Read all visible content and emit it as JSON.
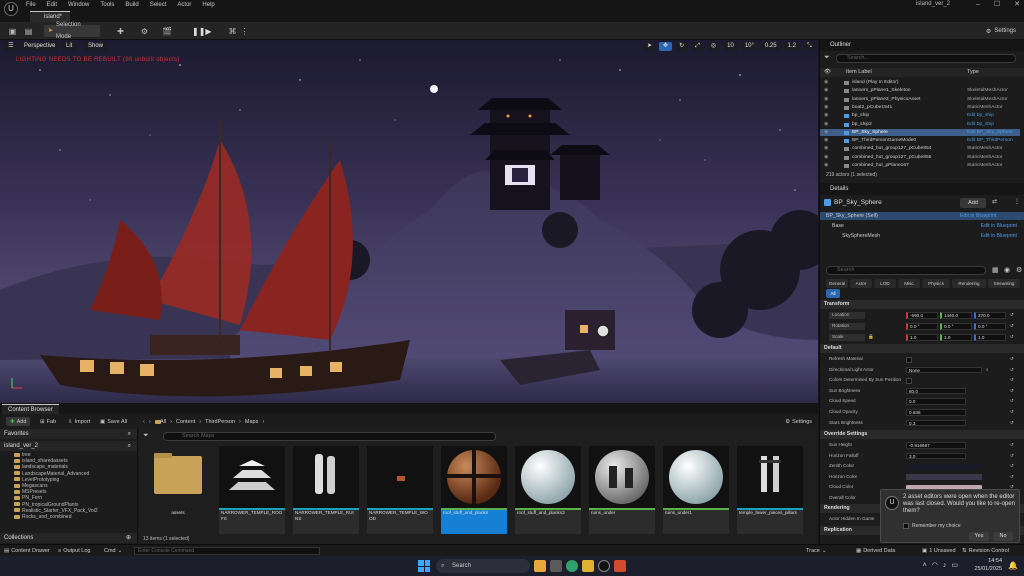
{
  "app": {
    "menu": [
      "File",
      "Edit",
      "Window",
      "Tools",
      "Build",
      "Select",
      "Actor",
      "Help"
    ],
    "project_title": "island_ver_2",
    "level_tab": "island*"
  },
  "toolbar": {
    "selection_mode": "Selection Mode",
    "settings": "Settings"
  },
  "viewport": {
    "perspective": "Perspective",
    "lit": "Lit",
    "show": "Show",
    "warning": "LIGHTING NEEDS TO BE REBUILT (98 unbuilt objects)",
    "snap_values": [
      "10",
      "10°",
      "0.25",
      "1.2"
    ]
  },
  "content_browser": {
    "tab": "Content Browser",
    "add": "Add",
    "import": "Import",
    "save_all": "Save All",
    "fab": "Fab",
    "settings": "Settings",
    "path": [
      "All",
      "Content",
      "ThirdPerson",
      "Maps"
    ],
    "favorites": "Favorites",
    "project_root": "island_ver_2",
    "collections": "Collections",
    "search_placeholder": "Search Maps",
    "tree": [
      "tree",
      "island_sharedassets",
      "landscape_materials",
      "LandscapeMaterial_Advanced",
      "LevelPrototyping",
      "Megascans",
      "MSPresets",
      "PN_Fern",
      "PN_tropicalGroundPlants",
      "Realistic_Starter_VFX_Pack_Vol2",
      "Rocks_and_combined"
    ],
    "assets": [
      {
        "label": "assets",
        "kind": "folder"
      },
      {
        "label": "NARROWER_TEMPLE_ROOFS",
        "kind": "pagoda"
      },
      {
        "label": "NARROWER_TEMPLE_RUINS",
        "kind": "ruins"
      },
      {
        "label": "NARROWER_TEMPLE_WOOD",
        "kind": "wood"
      },
      {
        "label": "roof_stuff_and_planks",
        "kind": "sphere-wood"
      },
      {
        "label": "roof_stuff_and_planks3",
        "kind": "sphere-white"
      },
      {
        "label": "ruins_under",
        "kind": "sphere-ruins"
      },
      {
        "label": "ruins_under1",
        "kind": "sphere-white"
      },
      {
        "label": "temple_fewer_pieces_pillars",
        "kind": "pillars"
      }
    ],
    "count": "13 items (1 selected)"
  },
  "outliner": {
    "tab": "Outliner",
    "search_placeholder": "Search...",
    "col_label": "Item Label",
    "col_type": "Type",
    "rows": [
      {
        "name": "island (Play In Editor)",
        "type": ""
      },
      {
        "name": "lanners_pPlane1_Skeleton",
        "type": "SkeletalMeshActor"
      },
      {
        "name": "lanners_pPlane2_PhysicsAsset",
        "type": "SkeletalMeshActor"
      },
      {
        "name": "boat2_pCube1541",
        "type": "StaticMeshActor"
      },
      {
        "name": "bp_ship",
        "type": "Edit bp_ship"
      },
      {
        "name": "bp_ship2",
        "type": "Edit bp_ship"
      },
      {
        "name": "BP_Sky_Sphere",
        "type": "Edit BP_Sky_Sphere"
      },
      {
        "name": "BP_ThirdPersonGameMode0",
        "type": "Edit BP_ThirdPerson"
      },
      {
        "name": "combined_hut_group127_pCube854",
        "type": "StaticMeshActor"
      },
      {
        "name": "combined_hut_group127_pCube855",
        "type": "StaticMeshActor"
      },
      {
        "name": "combined_hut_pPlane167",
        "type": "StaticMeshActor"
      }
    ],
    "count": "219 actors (1 selected)"
  },
  "details": {
    "tab": "Details",
    "actor_name": "BP_Sky_Sphere",
    "add": "Add",
    "components": [
      {
        "name": "BP_Sky_Sphere (Self)",
        "link": ""
      },
      {
        "name": "Base",
        "link": "Edit in Blueprint"
      },
      {
        "name": "SkySphereMesh",
        "link": "Edit in Blueprint"
      }
    ],
    "self_link": "Edit in Blueprint",
    "search_placeholder": "Search",
    "categories": [
      "General",
      "Actor",
      "LOD",
      "Misc",
      "Physics",
      "Rendering",
      "Streaming",
      "All"
    ],
    "transform_header": "Transform",
    "location": {
      "label": "Location",
      "x": "-590.0",
      "y": "1440.0",
      "z": "370.0"
    },
    "rotation": {
      "label": "Rotation",
      "x": "0.0 °",
      "y": "0.0 °",
      "z": "0.0 °"
    },
    "scale": {
      "label": "Scale",
      "x": "1.0",
      "y": "1.0",
      "z": "1.0"
    },
    "default_header": "Default",
    "default_props": [
      {
        "name": "Refresh Material",
        "value": "",
        "kind": "check"
      },
      {
        "name": "Directional Light Actor",
        "value": "None",
        "kind": "dropdown"
      },
      {
        "name": "Colors Determined By Sun Position",
        "value": "",
        "kind": "check"
      },
      {
        "name": "Sun Brightness",
        "value": "60.0",
        "kind": "num"
      },
      {
        "name": "Cloud Speed",
        "value": "0.0",
        "kind": "num"
      },
      {
        "name": "Cloud Opacity",
        "value": "0.636",
        "kind": "num"
      },
      {
        "name": "Stars Brightness",
        "value": "0.3",
        "kind": "num"
      }
    ],
    "override_header": "Override Settings",
    "override_props": [
      {
        "name": "Sun Height",
        "value": "-0.916667",
        "kind": "num"
      },
      {
        "name": "Horizon Falloff",
        "value": "3.0",
        "kind": "num"
      },
      {
        "name": "Zenith Color",
        "value": "#1a1a28",
        "kind": "color"
      },
      {
        "name": "Horizon Color",
        "value": "#3a3848",
        "kind": "color"
      },
      {
        "name": "Cloud Color",
        "value": "#c0a8b0",
        "kind": "color"
      },
      {
        "name": "Overall Color",
        "value": "#e8e8e8",
        "kind": "color"
      }
    ],
    "rendering_header": "Rendering",
    "actor_hidden": "Actor Hidden In Game",
    "replication_header": "Replication"
  },
  "notification": {
    "text": "2 asset editors were open when the editor was last closed. Would you like to re-open them?",
    "remember": "Remember my choice",
    "yes": "Yes",
    "no": "No"
  },
  "statusbar": {
    "content_drawer": "Content Drawer",
    "output_log": "Output Log",
    "cmd": "Cmd",
    "console_placeholder": "Enter Console Command",
    "trace": "Trace",
    "derived_data": "Derived Data",
    "unsaved": "1 Unsaved",
    "revision": "Revision Control"
  },
  "taskbar": {
    "search": "Search",
    "time": "14:54",
    "date": "25/01/2025"
  }
}
